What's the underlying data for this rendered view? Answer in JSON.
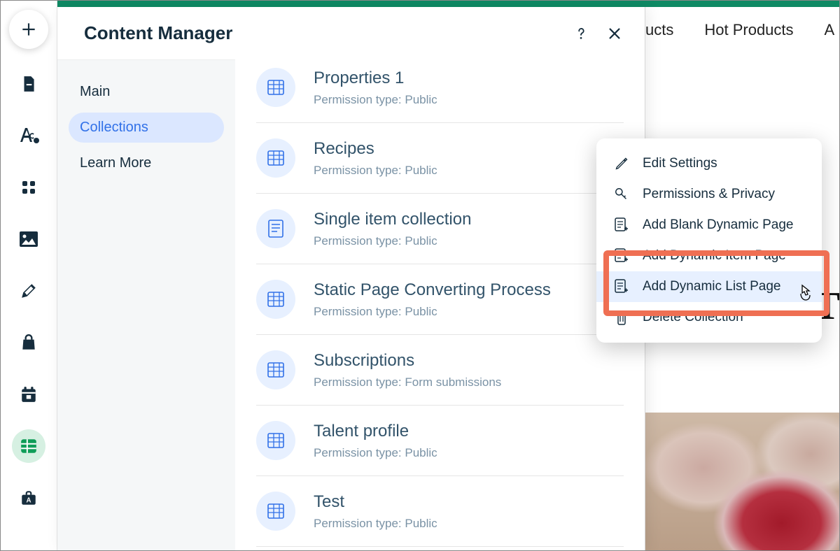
{
  "panel": {
    "title": "Content Manager"
  },
  "sidebar": {
    "items": [
      {
        "label": "Main",
        "active": false
      },
      {
        "label": "Collections",
        "active": true
      },
      {
        "label": "Learn More",
        "active": false
      }
    ]
  },
  "collections": [
    {
      "name": "Properties 1",
      "perm": "Permission type: Public",
      "icon": "table"
    },
    {
      "name": "Recipes",
      "perm": "Permission type: Public",
      "icon": "table",
      "more_open": true
    },
    {
      "name": "Single item collection",
      "perm": "Permission type: Public",
      "icon": "doc"
    },
    {
      "name": "Static Page Converting Process",
      "perm": "Permission type: Public",
      "icon": "table"
    },
    {
      "name": "Subscriptions",
      "perm": "Permission type: Form submissions",
      "icon": "table"
    },
    {
      "name": "Talent profile",
      "perm": "Permission type: Public",
      "icon": "table"
    },
    {
      "name": "Test",
      "perm": "Permission type: Public",
      "icon": "table"
    }
  ],
  "context_menu": {
    "items": [
      {
        "label": "Edit Settings",
        "icon": "pencil"
      },
      {
        "label": "Permissions & Privacy",
        "icon": "key"
      },
      {
        "label": "Add Blank Dynamic Page",
        "icon": "page-plus"
      },
      {
        "label": "Add Dynamic Item Page",
        "icon": "page-plus"
      },
      {
        "label": "Add Dynamic List Page",
        "icon": "page-plus",
        "hover": true
      },
      {
        "label": "Delete Collection",
        "icon": "trash"
      }
    ]
  },
  "site_nav": {
    "items": [
      "ucts",
      "Hot Products",
      "A"
    ]
  }
}
